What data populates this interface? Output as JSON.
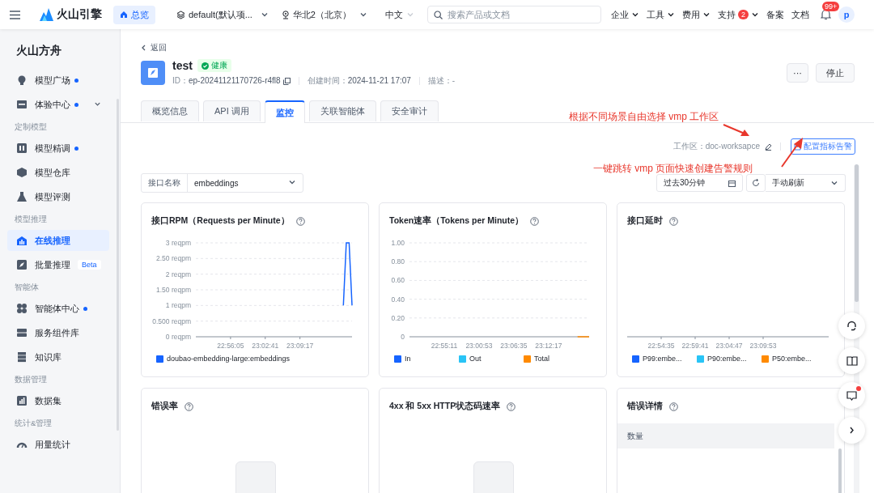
{
  "topbar": {
    "logo_text": "火山引擎",
    "home": {
      "label": "总览",
      "selected": true
    },
    "project": "default(默认项...",
    "region": "华北2（北京）",
    "language": "中文",
    "search": {
      "placeholder": "搜索产品或文档"
    },
    "nav": [
      {
        "label": "企业",
        "kind": "menu"
      },
      {
        "label": "工具",
        "kind": "menu"
      },
      {
        "label": "费用",
        "kind": "menu"
      },
      {
        "label": "支持",
        "kind": "menu",
        "badge": "2"
      },
      {
        "label": "备案",
        "kind": "link"
      },
      {
        "label": "文档",
        "kind": "link"
      }
    ],
    "notifications": "99+",
    "avatar": "p"
  },
  "sidebar": {
    "title": "火山方舟",
    "items": [
      {
        "kind": "item",
        "label": "模型广场",
        "new": true,
        "selected": false
      },
      {
        "kind": "item",
        "label": "体验中心",
        "new": true,
        "selected": false,
        "expanded": false
      },
      {
        "kind": "section",
        "label": "定制模型"
      },
      {
        "kind": "item",
        "label": "模型精调",
        "new": true,
        "selected": false
      },
      {
        "kind": "item",
        "label": "模型仓库",
        "new": false,
        "selected": false
      },
      {
        "kind": "item",
        "label": "模型评测",
        "new": false,
        "selected": false
      },
      {
        "kind": "section",
        "label": "模型推理"
      },
      {
        "kind": "item",
        "label": "在线推理",
        "new": false,
        "selected": true
      },
      {
        "kind": "item",
        "label": "批量推理",
        "new": false,
        "selected": false,
        "badge": "Beta"
      },
      {
        "kind": "section",
        "label": "智能体"
      },
      {
        "kind": "item",
        "label": "智能体中心",
        "new": true,
        "selected": false
      },
      {
        "kind": "item",
        "label": "服务组件库",
        "new": false,
        "selected": false
      },
      {
        "kind": "item",
        "label": "知识库",
        "new": false,
        "selected": false
      },
      {
        "kind": "section",
        "label": "数据管理"
      },
      {
        "kind": "item",
        "label": "数据集",
        "new": false,
        "selected": false
      },
      {
        "kind": "section",
        "label": "统计&管理"
      },
      {
        "kind": "item",
        "label": "用量统计",
        "new": false,
        "selected": false
      }
    ]
  },
  "endpoint": {
    "back": "返回",
    "name": "test",
    "status": "健康",
    "id_label": "ID：",
    "id": "ep-20241121170726-r4fl8",
    "created_label": "创建时间：",
    "created": "2024-11-21 17:07",
    "desc_label": "描述：",
    "desc": "-",
    "more": "···",
    "stop": "停止"
  },
  "tabs": [
    {
      "label": "概览信息",
      "selected": false
    },
    {
      "label": "API 调用",
      "selected": false
    },
    {
      "label": "监控",
      "selected": true
    },
    {
      "label": "关联智能体",
      "selected": false
    },
    {
      "label": "安全审计",
      "selected": false
    }
  ],
  "monitor": {
    "workspace_label": "工作区：",
    "workspace": "doc-worksapce",
    "alert_button": "配置指标告警",
    "filter": {
      "label": "接口名称",
      "value": "embeddings"
    },
    "time_range": "过去30分钟",
    "refresh": "手动刷新",
    "cards": [
      {
        "kind": "chart",
        "title": "接口RPM（Requests per Minute）",
        "chart_data": {
          "type": "line",
          "grid": true,
          "ylim": [
            0,
            3
          ],
          "categories": [
            null,
            null,
            null,
            null,
            null,
            null,
            null,
            null,
            null,
            null,
            null,
            null,
            "22:56:05",
            null,
            null,
            null,
            null,
            null,
            null,
            null,
            null,
            null,
            null,
            null,
            "23:02:41",
            null,
            null,
            null,
            null,
            null,
            null,
            null,
            null,
            null,
            null,
            null,
            "23:09:17",
            null,
            null,
            null,
            null,
            null,
            null,
            null,
            null,
            null,
            null,
            null,
            null,
            null,
            null,
            null,
            null,
            null,
            null
          ],
          "yticks": [
            {
              "value": 0,
              "label": "0 reqpm"
            },
            {
              "value": 0.5,
              "label": "0.500 reqpm"
            },
            {
              "value": 1,
              "label": "1 reqpm"
            },
            {
              "value": 1.5,
              "label": "1.50 reqpm"
            },
            {
              "value": 2,
              "label": "2 reqpm"
            },
            {
              "value": 2.5,
              "label": "2.50 reqpm"
            },
            {
              "value": 3,
              "label": "3 reqpm"
            }
          ],
          "series": [
            {
              "name": "doubao-embedding-large:embeddings",
              "color": "#1664ff",
              "values": [
                null,
                null,
                null,
                null,
                null,
                null,
                null,
                null,
                null,
                null,
                null,
                null,
                null,
                null,
                null,
                null,
                null,
                null,
                null,
                null,
                null,
                null,
                null,
                null,
                null,
                null,
                null,
                null,
                null,
                null,
                null,
                null,
                null,
                null,
                null,
                null,
                null,
                null,
                null,
                null,
                null,
                null,
                null,
                null,
                null,
                null,
                null,
                null,
                null,
                null,
                null,
                1,
                3,
                3,
                1
              ]
            }
          ]
        }
      },
      {
        "kind": "chart",
        "title": "Token速率（Tokens per Minute）",
        "chart_data": {
          "type": "line",
          "grid": true,
          "ylim": [
            0,
            1
          ],
          "categories": [
            null,
            null,
            null,
            null,
            null,
            null,
            "22:55:11",
            null,
            null,
            null,
            null,
            null,
            "23:00:53",
            null,
            null,
            null,
            null,
            null,
            "23:06:35",
            null,
            null,
            null,
            null,
            null,
            "23:12:17",
            null,
            null,
            null,
            null,
            null,
            null,
            null
          ],
          "yticks": [
            {
              "value": 0,
              "label": "0"
            },
            {
              "value": 0.2,
              "label": "0.20"
            },
            {
              "value": 0.4,
              "label": "0.40"
            },
            {
              "value": 0.6,
              "label": "0.60"
            },
            {
              "value": 0.8,
              "label": "0.80"
            },
            {
              "value": 1,
              "label": "1.00"
            }
          ],
          "series": [
            {
              "name": "In",
              "color": "#1664ff",
              "values": [
                null,
                null,
                null,
                null,
                null,
                null,
                null,
                null,
                null,
                null,
                null,
                null,
                null,
                null,
                null,
                null,
                null,
                null,
                null,
                null,
                null,
                null,
                null,
                null,
                null,
                null,
                null,
                null,
                null,
                null,
                null,
                null
              ]
            },
            {
              "name": "Out",
              "color": "#29c4f6",
              "values": [
                null,
                null,
                null,
                null,
                null,
                null,
                null,
                null,
                null,
                null,
                null,
                null,
                null,
                null,
                null,
                null,
                null,
                null,
                null,
                null,
                null,
                null,
                null,
                null,
                null,
                null,
                null,
                null,
                null,
                null,
                null,
                null
              ]
            },
            {
              "name": "Total",
              "color": "#ff8a00",
              "values": [
                null,
                null,
                null,
                null,
                null,
                null,
                null,
                null,
                null,
                null,
                null,
                null,
                null,
                null,
                null,
                null,
                null,
                null,
                null,
                null,
                null,
                null,
                null,
                null,
                null,
                null,
                null,
                null,
                null,
                0,
                0,
                0
              ]
            }
          ]
        }
      },
      {
        "kind": "blank-chart",
        "title": "接口延时",
        "time_labels": [
          "22:54:35",
          "22:59:41",
          "23:04:47",
          "23:09:53"
        ],
        "legend": [
          {
            "name": "P99:embe...",
            "color": "#1664ff"
          },
          {
            "name": "P90:embe...",
            "color": "#29c4f6"
          },
          {
            "name": "P50:embe...",
            "color": "#ff8a00"
          }
        ]
      },
      {
        "kind": "empty",
        "title": "错误率"
      },
      {
        "kind": "empty",
        "title": "4xx 和 5xx HTTP状态码速率"
      },
      {
        "kind": "table",
        "title": "错误详情",
        "columns": [
          "数量"
        ]
      }
    ]
  },
  "annotations": [
    {
      "text": "根据不同场景自由选择 vmp 工作区"
    },
    {
      "text": "一键跳转 vmp 页面快速创建告警规则"
    }
  ],
  "floating": {
    "messages_unread": true
  }
}
